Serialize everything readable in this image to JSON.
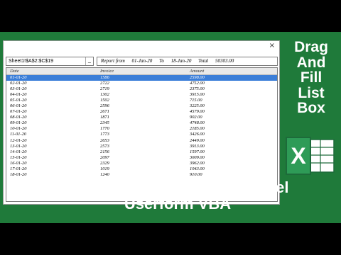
{
  "form": {
    "close_label": "×",
    "refedit_value": "Sheet1!$A$2:$C$19",
    "refedit_drop": "_",
    "report": {
      "label": "Report from",
      "from": "01-Jan-20",
      "to_label": "To",
      "to": "18-Jan-20",
      "total_label": "Total",
      "total": "50303.00"
    }
  },
  "listbox": {
    "headers": [
      "Date",
      "Invoice",
      "Amount"
    ],
    "rows": [
      [
        "01-01-20",
        "1586",
        "2598.00"
      ],
      [
        "02-01-20",
        "2722",
        "4752.00"
      ],
      [
        "03-01-20",
        "2719",
        "2375.00"
      ],
      [
        "04-01-20",
        "1302",
        "3915.00"
      ],
      [
        "05-01-20",
        "1502",
        "715.00"
      ],
      [
        "06-01-20",
        "2596",
        "3225.00"
      ],
      [
        "07-01-20",
        "2671",
        "4579.00"
      ],
      [
        "08-01-20",
        "1871",
        "902.00"
      ],
      [
        "09-01-20",
        "2345",
        "4748.00"
      ],
      [
        "10-01-20",
        "1770",
        "2185.00"
      ],
      [
        "11-01-20",
        "1773",
        "3426.00"
      ],
      [
        "12-01-20",
        "2653",
        "2449.00"
      ],
      [
        "13-01-20",
        "2573",
        "3913.00"
      ],
      [
        "14-01-20",
        "2156",
        "1597.00"
      ],
      [
        "15-01-20",
        "2097",
        "3009.00"
      ],
      [
        "16-01-20",
        "2329",
        "3962.00"
      ],
      [
        "17-01-20",
        "1019",
        "1043.00"
      ],
      [
        "18-01-20",
        "1240",
        "910.00"
      ]
    ],
    "selected_index": 0
  },
  "side_title": [
    "Drag",
    "And",
    "Fill",
    "List",
    "Box"
  ],
  "bottom_title": {
    "line1": "Listbox Data By RefEdit Excel",
    "line2": "Userform VBA"
  },
  "excel_icon": {
    "letter": "X"
  },
  "colors": {
    "background": "#1f7a3a",
    "selection": "#3b7ed8",
    "excel_dark": "#1d6b3a",
    "excel_light": "#2e9b57"
  }
}
